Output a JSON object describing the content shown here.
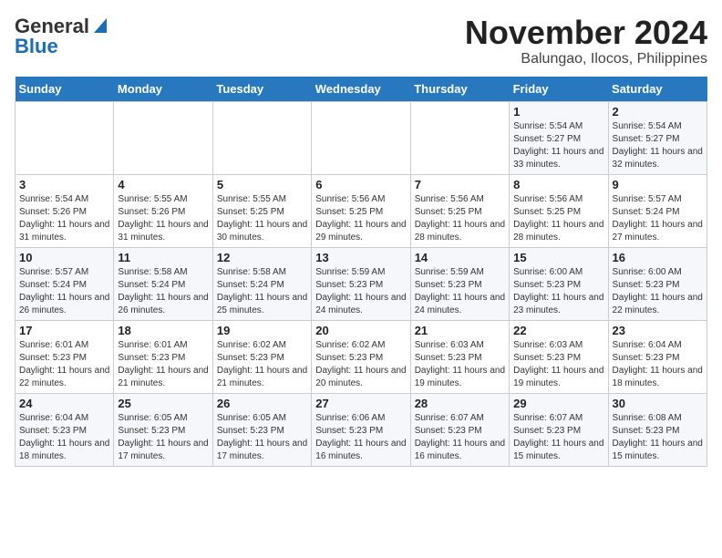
{
  "header": {
    "logo_general": "General",
    "logo_blue": "Blue",
    "title": "November 2024",
    "subtitle": "Balungao, Ilocos, Philippines"
  },
  "weekdays": [
    "Sunday",
    "Monday",
    "Tuesday",
    "Wednesday",
    "Thursday",
    "Friday",
    "Saturday"
  ],
  "weeks": [
    [
      {
        "day": "",
        "info": ""
      },
      {
        "day": "",
        "info": ""
      },
      {
        "day": "",
        "info": ""
      },
      {
        "day": "",
        "info": ""
      },
      {
        "day": "",
        "info": ""
      },
      {
        "day": "1",
        "info": "Sunrise: 5:54 AM\nSunset: 5:27 PM\nDaylight: 11 hours\nand 33 minutes."
      },
      {
        "day": "2",
        "info": "Sunrise: 5:54 AM\nSunset: 5:27 PM\nDaylight: 11 hours\nand 32 minutes."
      }
    ],
    [
      {
        "day": "3",
        "info": "Sunrise: 5:54 AM\nSunset: 5:26 PM\nDaylight: 11 hours\nand 31 minutes."
      },
      {
        "day": "4",
        "info": "Sunrise: 5:55 AM\nSunset: 5:26 PM\nDaylight: 11 hours\nand 31 minutes."
      },
      {
        "day": "5",
        "info": "Sunrise: 5:55 AM\nSunset: 5:25 PM\nDaylight: 11 hours\nand 30 minutes."
      },
      {
        "day": "6",
        "info": "Sunrise: 5:56 AM\nSunset: 5:25 PM\nDaylight: 11 hours\nand 29 minutes."
      },
      {
        "day": "7",
        "info": "Sunrise: 5:56 AM\nSunset: 5:25 PM\nDaylight: 11 hours\nand 28 minutes."
      },
      {
        "day": "8",
        "info": "Sunrise: 5:56 AM\nSunset: 5:25 PM\nDaylight: 11 hours\nand 28 minutes."
      },
      {
        "day": "9",
        "info": "Sunrise: 5:57 AM\nSunset: 5:24 PM\nDaylight: 11 hours\nand 27 minutes."
      }
    ],
    [
      {
        "day": "10",
        "info": "Sunrise: 5:57 AM\nSunset: 5:24 PM\nDaylight: 11 hours\nand 26 minutes."
      },
      {
        "day": "11",
        "info": "Sunrise: 5:58 AM\nSunset: 5:24 PM\nDaylight: 11 hours\nand 26 minutes."
      },
      {
        "day": "12",
        "info": "Sunrise: 5:58 AM\nSunset: 5:24 PM\nDaylight: 11 hours\nand 25 minutes."
      },
      {
        "day": "13",
        "info": "Sunrise: 5:59 AM\nSunset: 5:23 PM\nDaylight: 11 hours\nand 24 minutes."
      },
      {
        "day": "14",
        "info": "Sunrise: 5:59 AM\nSunset: 5:23 PM\nDaylight: 11 hours\nand 24 minutes."
      },
      {
        "day": "15",
        "info": "Sunrise: 6:00 AM\nSunset: 5:23 PM\nDaylight: 11 hours\nand 23 minutes."
      },
      {
        "day": "16",
        "info": "Sunrise: 6:00 AM\nSunset: 5:23 PM\nDaylight: 11 hours\nand 22 minutes."
      }
    ],
    [
      {
        "day": "17",
        "info": "Sunrise: 6:01 AM\nSunset: 5:23 PM\nDaylight: 11 hours\nand 22 minutes."
      },
      {
        "day": "18",
        "info": "Sunrise: 6:01 AM\nSunset: 5:23 PM\nDaylight: 11 hours\nand 21 minutes."
      },
      {
        "day": "19",
        "info": "Sunrise: 6:02 AM\nSunset: 5:23 PM\nDaylight: 11 hours\nand 21 minutes."
      },
      {
        "day": "20",
        "info": "Sunrise: 6:02 AM\nSunset: 5:23 PM\nDaylight: 11 hours\nand 20 minutes."
      },
      {
        "day": "21",
        "info": "Sunrise: 6:03 AM\nSunset: 5:23 PM\nDaylight: 11 hours\nand 19 minutes."
      },
      {
        "day": "22",
        "info": "Sunrise: 6:03 AM\nSunset: 5:23 PM\nDaylight: 11 hours\nand 19 minutes."
      },
      {
        "day": "23",
        "info": "Sunrise: 6:04 AM\nSunset: 5:23 PM\nDaylight: 11 hours\nand 18 minutes."
      }
    ],
    [
      {
        "day": "24",
        "info": "Sunrise: 6:04 AM\nSunset: 5:23 PM\nDaylight: 11 hours\nand 18 minutes."
      },
      {
        "day": "25",
        "info": "Sunrise: 6:05 AM\nSunset: 5:23 PM\nDaylight: 11 hours\nand 17 minutes."
      },
      {
        "day": "26",
        "info": "Sunrise: 6:05 AM\nSunset: 5:23 PM\nDaylight: 11 hours\nand 17 minutes."
      },
      {
        "day": "27",
        "info": "Sunrise: 6:06 AM\nSunset: 5:23 PM\nDaylight: 11 hours\nand 16 minutes."
      },
      {
        "day": "28",
        "info": "Sunrise: 6:07 AM\nSunset: 5:23 PM\nDaylight: 11 hours\nand 16 minutes."
      },
      {
        "day": "29",
        "info": "Sunrise: 6:07 AM\nSunset: 5:23 PM\nDaylight: 11 hours\nand 15 minutes."
      },
      {
        "day": "30",
        "info": "Sunrise: 6:08 AM\nSunset: 5:23 PM\nDaylight: 11 hours\nand 15 minutes."
      }
    ]
  ]
}
